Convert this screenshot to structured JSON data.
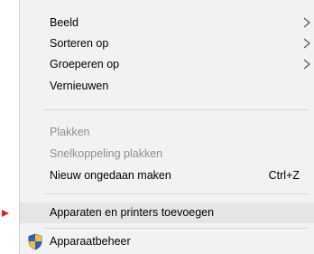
{
  "context_menu": {
    "items": [
      {
        "label": "Beeld",
        "submenu": true
      },
      {
        "label": "Sorteren op",
        "submenu": true
      },
      {
        "label": "Groeperen op",
        "submenu": true
      },
      {
        "label": "Vernieuwen"
      },
      {
        "label": "Plakken",
        "disabled": true
      },
      {
        "label": "Snelkoppeling plakken",
        "disabled": true
      },
      {
        "label": "Nieuw ongedaan maken",
        "shortcut": "Ctrl+Z"
      },
      {
        "label": "Apparaten en printers toevoegen",
        "highlighted": true
      },
      {
        "label": "Apparaatbeheer",
        "icon": "uac-shield-icon"
      }
    ]
  },
  "colors": {
    "menu_background": "#f2f2f2",
    "highlight": "#e5e5e5",
    "disabled_text": "#8e8e8e",
    "separator": "#d5d5d5",
    "pointer_marker": "#e02020"
  }
}
